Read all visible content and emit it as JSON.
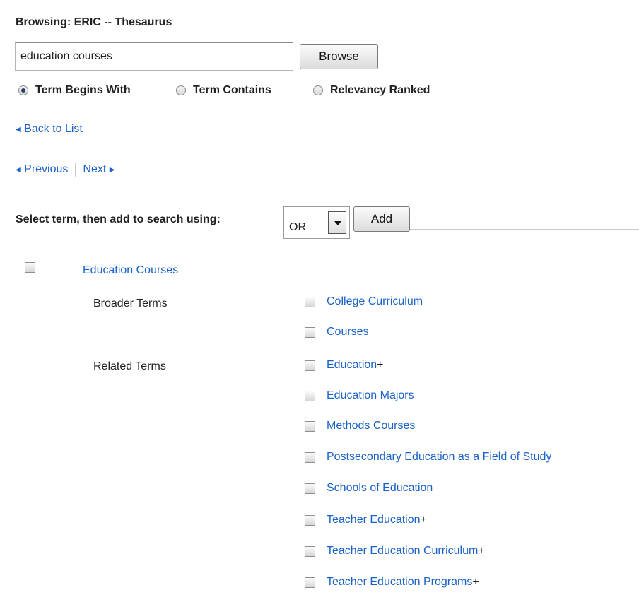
{
  "header": {
    "title": "Browsing: ERIC -- Thesaurus"
  },
  "search": {
    "value": "education courses",
    "browse_label": "Browse"
  },
  "radios": [
    {
      "label": "Term Begins With",
      "checked": true
    },
    {
      "label": "Term Contains",
      "checked": false
    },
    {
      "label": "Relevancy Ranked",
      "checked": false
    }
  ],
  "nav": {
    "back": "Back to List",
    "previous": "Previous",
    "next": "Next"
  },
  "add_bar": {
    "label": "Select term, then add to search using:",
    "operator": "OR",
    "add_label": "Add"
  },
  "term": {
    "name": "Education Courses",
    "broader_label": "Broader Terms",
    "related_label": "Related Terms",
    "broader": [
      {
        "label": "College Curriculum",
        "plus": ""
      },
      {
        "label": "Courses",
        "plus": ""
      }
    ],
    "related": [
      {
        "label": "Education",
        "plus": "+"
      },
      {
        "label": "Education Majors",
        "plus": ""
      },
      {
        "label": "Methods Courses",
        "plus": ""
      },
      {
        "label": "Postsecondary Education as a Field of Study",
        "plus": ""
      },
      {
        "label": "Schools of Education",
        "plus": ""
      },
      {
        "label": "Teacher Education",
        "plus": "+"
      },
      {
        "label": "Teacher Education Curriculum",
        "plus": "+"
      },
      {
        "label": "Teacher Education Programs",
        "plus": "+"
      }
    ]
  }
}
